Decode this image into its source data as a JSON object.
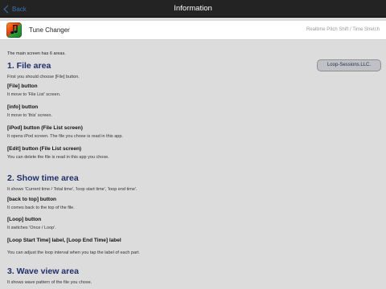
{
  "navbar": {
    "back_label": "Back",
    "title": "Information"
  },
  "app": {
    "name": "Tune Changer",
    "subtitle": "Realtime Pitch Shift / Time Stretch",
    "icon": "music-note-icon"
  },
  "content": {
    "intro": "The main screen has 6 areas.",
    "credit_button": "Loop-Sessions.LLC.",
    "sections": [
      {
        "title": "1. File area",
        "text": "First you should choose [File] button."
      },
      {
        "title": "2. Show time area",
        "text": "It shows 'Current time / Total time', 'loop start time', 'loop end time'."
      },
      {
        "title": "3. Wave view area",
        "text": "It shows wave pattern of the file you chose."
      }
    ],
    "items": [
      {
        "title": "[File] button",
        "text": "It move to 'File List' screen."
      },
      {
        "title": "[info] button",
        "text": "It move to 'this' screen."
      },
      {
        "title": "[iPod] button (File List screen)",
        "text": "It opens iPod screen. The file you chose is read in this app."
      },
      {
        "title": "[Edit] button (File List screen)",
        "text": "You can delete the file is read in this app you chose."
      },
      {
        "title": "[back to top] button",
        "text": "It comes back to the top of the file."
      },
      {
        "title": "[Loop] button",
        "text": "It switches 'Once / Loop'."
      },
      {
        "title": "[Loop Start Time] label, [Loop End Time] label",
        "text": "You can adjust the loop interval when you tap the label of each part."
      }
    ]
  },
  "colors": {
    "navbar": "#232323",
    "back": "#3c6fb5",
    "section_heading": "#1f2f6b",
    "background": "#dcdcdc"
  }
}
